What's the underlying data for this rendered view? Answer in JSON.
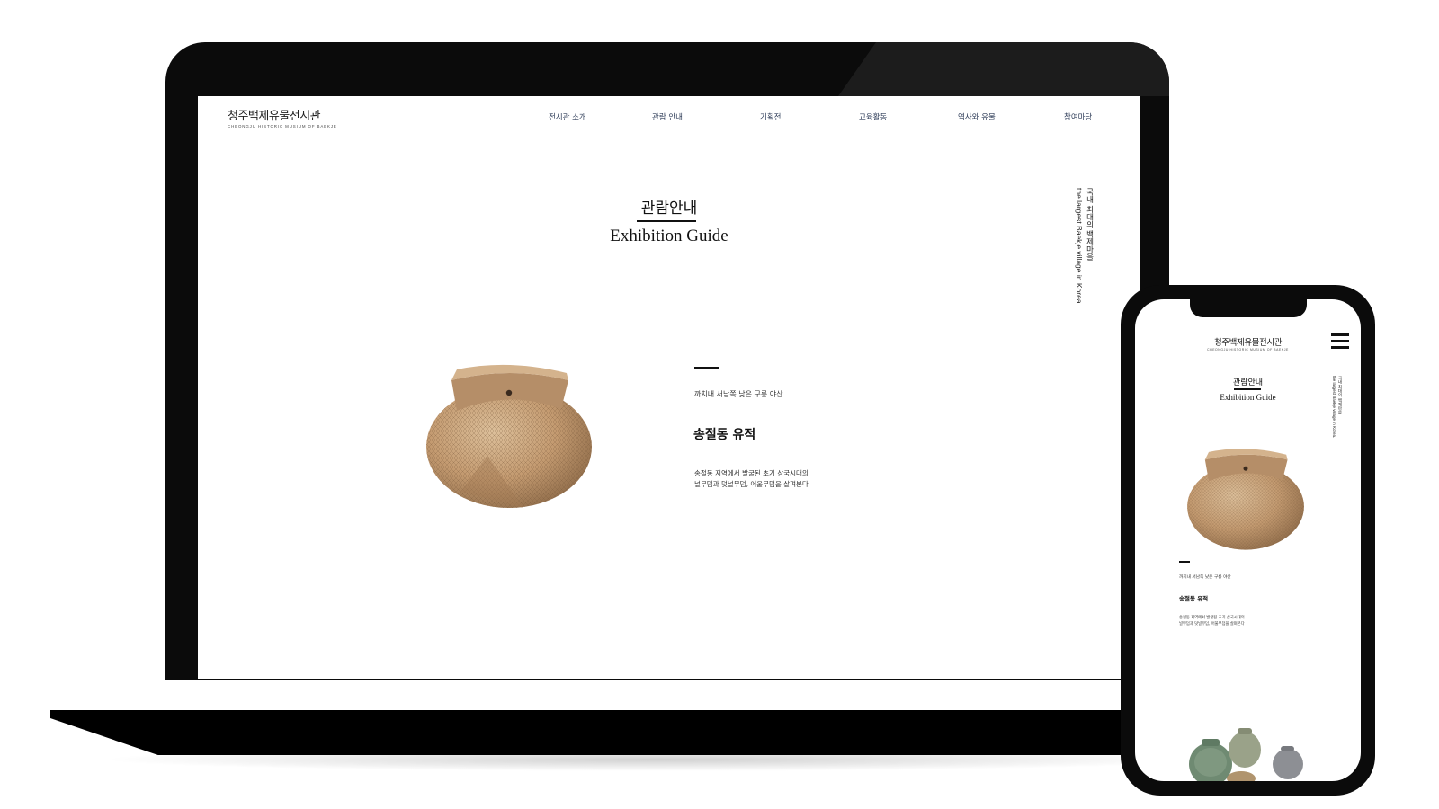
{
  "desktop": {
    "logo": {
      "korean": "청주백제유물전시관",
      "english": "CHEONGJU HISTORIC MUSIUM OF BAEKJE"
    },
    "nav": [
      {
        "label": "전시관 소개"
      },
      {
        "label": "관람 안내"
      },
      {
        "label": "기획전"
      },
      {
        "label": "교육활동"
      },
      {
        "label": "역사와 유물"
      },
      {
        "label": "참여마당"
      }
    ],
    "page_title_ko": "관람안내",
    "page_title_en": "Exhibition Guide",
    "side_caption_ko": "국내 최대의 백제마을",
    "side_caption_en": "the largest Baekje village in Korea.",
    "feature": {
      "subtitle": "까치내 서남쪽 낮은 구릉 야산",
      "heading": "송절동 유적",
      "desc_line1": "송절동 지역에서 발굴된 초기 삼국시대의",
      "desc_line2": "널무덤과 덧널무덤, 어울무덤을 살펴본다"
    }
  },
  "mobile": {
    "logo": {
      "korean": "청주백제유물전시관",
      "english": "CHEONGJU HISTORIC MUSIUM OF BAEKJE"
    },
    "page_title_ko": "관람안내",
    "page_title_en": "Exhibition Guide",
    "side_caption_ko": "국내 최대의 백제마을",
    "side_caption_en": "the largest Baekje village in Korea.",
    "feature": {
      "subtitle": "까치내 서남쪽 낮은 구릉 야산",
      "heading": "송절동 유적",
      "desc_line1": "송절동 지역에서 발굴된 초기 삼국시대의",
      "desc_line2": "널무덤과 덧널무덤, 어울무덤을 살펴본다"
    }
  },
  "icons": {
    "menu": "hamburger-menu-icon"
  },
  "colors": {
    "nav_text": "#2f3d59",
    "device_frame": "#0b0b0b",
    "pot_clay": "#c9a27a"
  }
}
